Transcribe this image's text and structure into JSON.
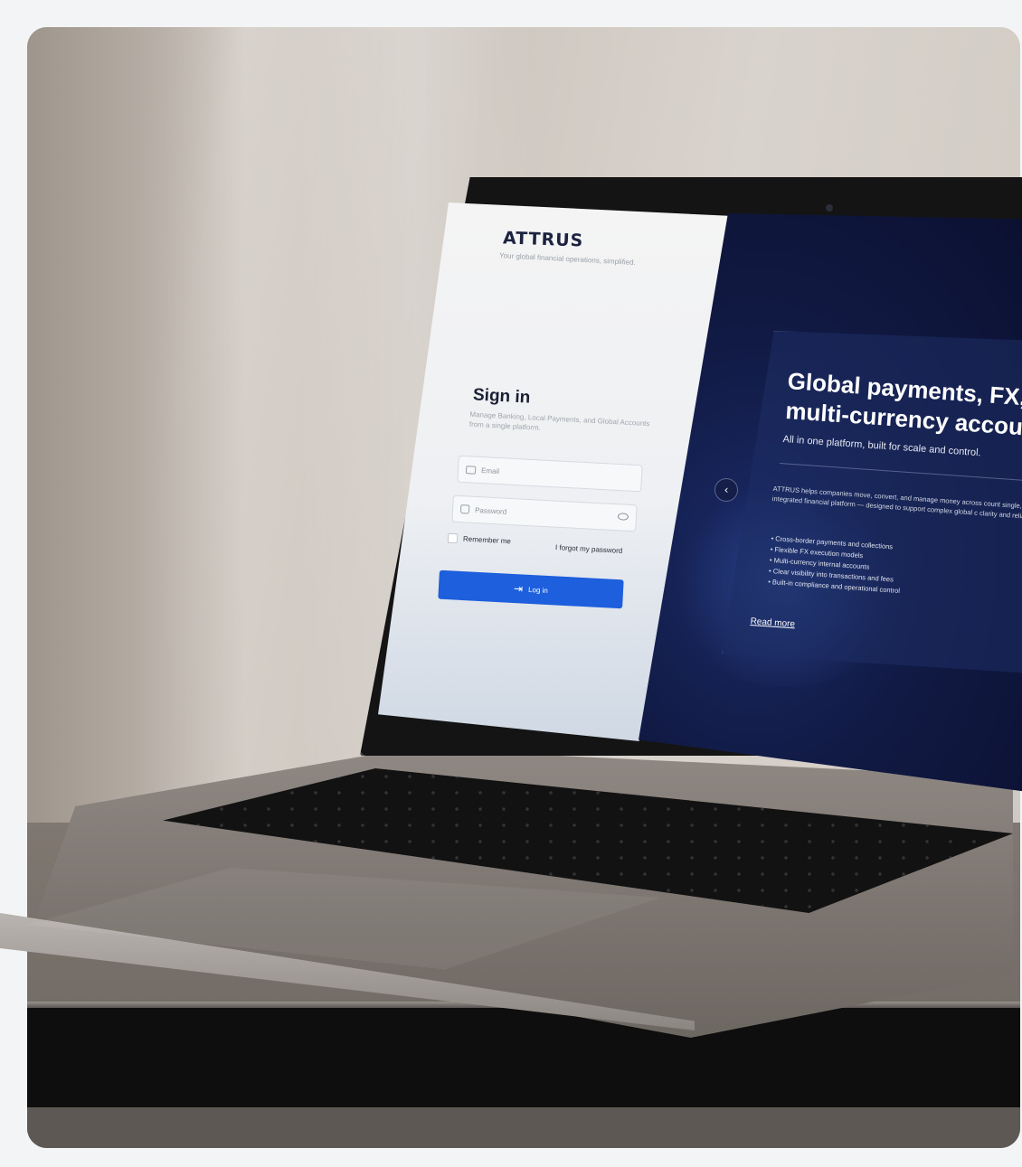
{
  "brand": {
    "logo": "ATTRUS",
    "tagline": "Your global financial operations, simplified."
  },
  "signin": {
    "title": "Sign in",
    "subtitle": "Manage Banking, Local Payments, and Global Accounts from a single platform.",
    "email_placeholder": "Email",
    "password_placeholder": "Password",
    "remember_label": "Remember me",
    "forgot_label": "I forgot my password",
    "login_label": "Log in",
    "button_color": "#1d5fdc"
  },
  "hero": {
    "title_line1": "Global payments, FX, ar",
    "title_line2": "multi-currency accounts",
    "subtitle": "All in one platform, built for scale and control.",
    "body": "ATTRUS helps companies move, convert, and manage money across count single, integrated financial platform — designed to support complex global c clarity and reliability.",
    "bullets": [
      "Cross-border payments and collections",
      "Flexible FX execution models",
      "Multi-currency internal accounts",
      "Clear visibility into transactions and fees",
      "Built-in compliance and operational control"
    ],
    "read_more": "Read more",
    "prev_icon": "chevron-left-icon"
  }
}
